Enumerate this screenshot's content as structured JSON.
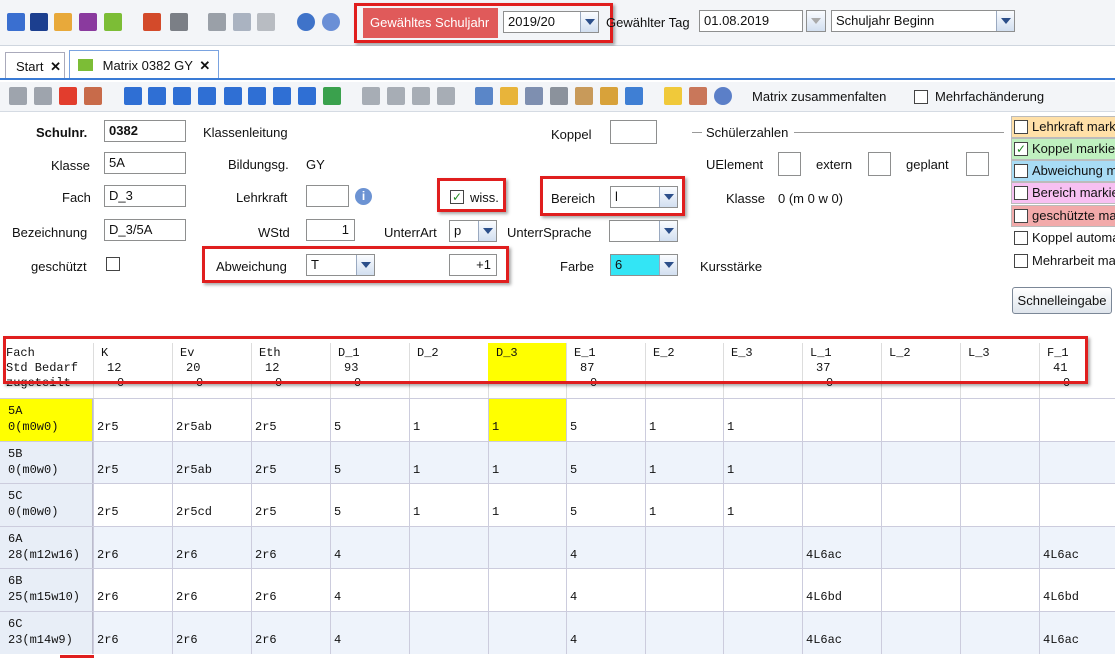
{
  "toolbar_top": {
    "schuljahr_label": "Gewähltes Schuljahr",
    "schuljahr_value": "2019/20",
    "tag_label": "Gewählter Tag",
    "tag_value": "01.08.2019",
    "mode_value": "Schuljahr Beginn"
  },
  "tabs": [
    {
      "label": "Start",
      "close": "✕"
    },
    {
      "label": "Matrix 0382 GY",
      "close": "✕"
    }
  ],
  "toolbar2": {
    "zusammenfalten": "Matrix zusammenfalten",
    "mehrfach": "Mehrfachänderung"
  },
  "form": {
    "schulnr_label": "Schulnr.",
    "schulnr": "0382",
    "klassenleitung_label": "Klassenleitung",
    "klasse_label": "Klasse",
    "klasse": "5A",
    "bildungsg_label": "Bildungsg.",
    "bildungsg": "GY",
    "fach_label": "Fach",
    "fach": "D_3",
    "lehrkraft_label": "Lehrkraft",
    "lehrkraft": "",
    "wiss_label": "wiss.",
    "bezeichnung_label": "Bezeichnung",
    "bezeichnung": "D_3/5A",
    "wstd_label": "WStd",
    "wstd": "1",
    "unterrart_label": "UnterrArt",
    "unterrart": "p",
    "unterrsprache_label": "UnterrSprache",
    "unterrsprache": "",
    "geschuetzt_label": "geschützt",
    "abweichung_label": "Abweichung",
    "abweichung": "T",
    "abweichung_value": "+1",
    "koppel_label": "Koppel",
    "koppel": "",
    "bereich_label": "Bereich",
    "bereich": "l",
    "farbe_label": "Farbe",
    "farbe": "6",
    "kursstaerke_label": "Kursstärke",
    "schuelerzahlen_label": "Schülerzahlen",
    "uelement_label": "UElement",
    "extern_label": "extern",
    "geplant_label": "geplant",
    "klasse2_label": "Klasse",
    "klasse2_value": "0 (m 0 w 0)"
  },
  "legend": [
    {
      "label": "Lehrkraft markiert",
      "color": "#ffe0a8",
      "checked": false
    },
    {
      "label": "Koppel markiert",
      "color": "#bff0bf",
      "checked": true
    },
    {
      "label": "Abweichung markiert",
      "color": "#a8dcf5",
      "checked": false
    },
    {
      "label": "Bereich markiert",
      "color": "#f7c0f2",
      "checked": false
    },
    {
      "label": "geschützte markiert",
      "color": "#f2aaaa",
      "checked": false
    },
    {
      "label": "Koppel automatisch",
      "color": "#ffffff",
      "checked": false
    },
    {
      "label": "Mehrarbeit markiert",
      "color": "#ffffff",
      "checked": false
    }
  ],
  "schnelleingabe": "Schnelleingabe",
  "matrix": {
    "header_labels": [
      "Fach",
      "Std Bedarf",
      "zugeteilt"
    ],
    "columns": [
      {
        "fach": "K",
        "bedarf": "12",
        "zugeteilt": "0"
      },
      {
        "fach": "Ev",
        "bedarf": "20",
        "zugeteilt": "0"
      },
      {
        "fach": "Eth",
        "bedarf": "12",
        "zugeteilt": "0"
      },
      {
        "fach": "D_1",
        "bedarf": "93",
        "zugeteilt": "0"
      },
      {
        "fach": "D_2",
        "bedarf": "",
        "zugeteilt": ""
      },
      {
        "fach": "D_3",
        "bedarf": "",
        "zugeteilt": ""
      },
      {
        "fach": "E_1",
        "bedarf": "87",
        "zugeteilt": "0"
      },
      {
        "fach": "E_2",
        "bedarf": "",
        "zugeteilt": ""
      },
      {
        "fach": "E_3",
        "bedarf": "",
        "zugeteilt": ""
      },
      {
        "fach": "L_1",
        "bedarf": "37",
        "zugeteilt": "0"
      },
      {
        "fach": "L_2",
        "bedarf": "",
        "zugeteilt": ""
      },
      {
        "fach": "L_3",
        "bedarf": "",
        "zugeteilt": ""
      },
      {
        "fach": "F_1",
        "bedarf": "41",
        "zugeteilt": "0"
      }
    ],
    "rows": [
      {
        "klasse": "5A",
        "info": "0(m0w0)",
        "cells": [
          "2r5",
          "2r5ab",
          "2r5",
          "5",
          "1",
          "1",
          "5",
          "1",
          "1",
          "",
          "",
          "",
          ""
        ]
      },
      {
        "klasse": "5B",
        "info": "0(m0w0)",
        "cells": [
          "2r5",
          "2r5ab",
          "2r5",
          "5",
          "1",
          "1",
          "5",
          "1",
          "1",
          "",
          "",
          "",
          ""
        ]
      },
      {
        "klasse": "5C",
        "info": "0(m0w0)",
        "cells": [
          "2r5",
          "2r5cd",
          "2r5",
          "5",
          "1",
          "1",
          "5",
          "1",
          "1",
          "",
          "",
          "",
          ""
        ]
      },
      {
        "klasse": "6A",
        "info": "28(m12w16)",
        "cells": [
          "2r6",
          "2r6",
          "2r6",
          "4",
          "",
          "",
          "4",
          "",
          "",
          "4L6ac",
          "",
          "",
          "4L6ac"
        ]
      },
      {
        "klasse": "6B",
        "info": "25(m15w10)",
        "cells": [
          "2r6",
          "2r6",
          "2r6",
          "4",
          "",
          "",
          "4",
          "",
          "",
          "4L6bd",
          "",
          "",
          "4L6bd"
        ]
      },
      {
        "klasse": "6C",
        "info": "23(m14w9)",
        "cells": [
          "2r6",
          "2r6",
          "2r6",
          "4",
          "",
          "",
          "4",
          "",
          "",
          "4L6ac",
          "",
          "",
          "4L6ac"
        ]
      }
    ]
  },
  "colors": {
    "highlight": "#ffff00",
    "alt_row": "#eef3fb",
    "red": "#e01e1e",
    "farbe": "#33e5f5",
    "schuljahr_bg": "#e05a5a"
  }
}
